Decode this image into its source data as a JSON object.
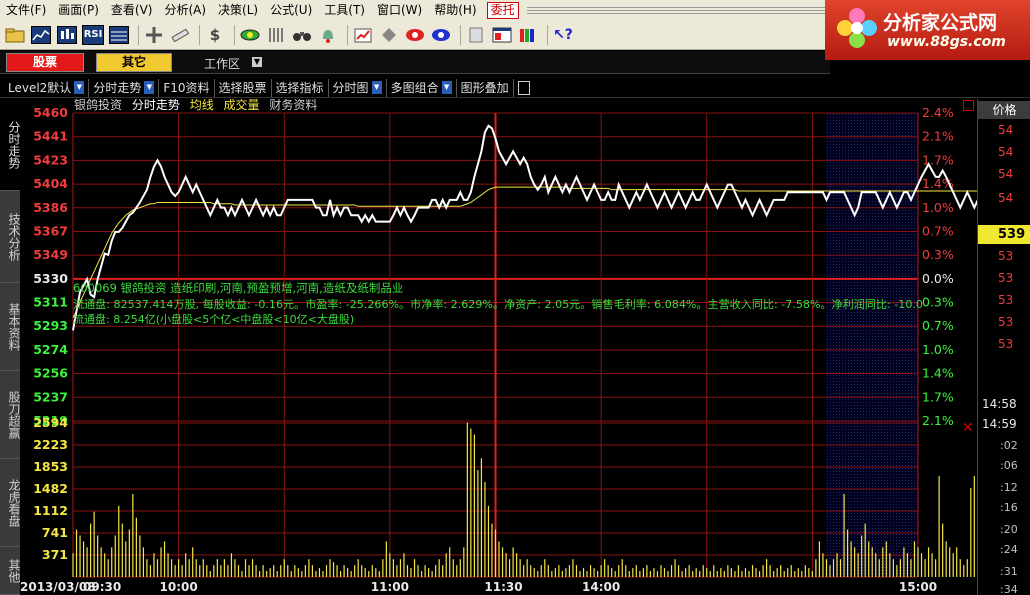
{
  "menus": [
    "文件(F)",
    "画面(P)",
    "查看(V)",
    "分析(A)",
    "决策(L)",
    "公式(U)",
    "工具(T)",
    "窗口(W)",
    "帮助(H)"
  ],
  "entrust_label": "委托",
  "logo": {
    "title": "分析家公式网",
    "url": "www.88gs.com"
  },
  "toolbar_rsi": "RSI",
  "sector_tabs": {
    "stocks": "股票",
    "other": "其它",
    "workspace": "工作区"
  },
  "func_tabs": [
    "Level2默认",
    "分时走势",
    "F10资料",
    "选择股票",
    "选择指标",
    "分时图",
    "多图组合",
    "图形叠加"
  ],
  "side_tabs": [
    "分时走势",
    "技术分析",
    "基本资料",
    "股刀超赢",
    "龙虎看盘",
    "其他"
  ],
  "chart_header": [
    "银鸽投资",
    "分时走势",
    "均线",
    "成交量",
    "财务资料"
  ],
  "colors": {
    "price_line": "#ffffff",
    "avg_line": "#f5e642",
    "volume": "#f5e642",
    "grid": "#b01818",
    "up": "#f03c3c",
    "down": "#3cf03c",
    "info_text": "#3cdc3c"
  },
  "info_lines": [
    "600069 银鸽投资 造纸印刷,河南,预盈预增,河南,造纸及纸制品业",
    "流通盘: 82537.414万股, 每股收益: -0.16元。市盈率: -25.266%。市净率: 2.629%。净资产: 2.05元。销售毛利率: 6.084%。主营收入同比: -7.58%。净利润同比: -10.0",
    "流通盘: 8.254亿(小盘股<5个亿<中盘股<10亿<大盘股)"
  ],
  "price_axis": [
    "5460",
    "5441",
    "5423",
    "5404",
    "5386",
    "5367",
    "5349",
    "5330",
    "5311",
    "5293",
    "5274",
    "5256",
    "5237",
    "5219"
  ],
  "pct_axis": [
    "2.4%",
    "2.1%",
    "1.7%",
    "1.4%",
    "1.0%",
    "0.7%",
    "0.3%",
    "0.0%",
    "0.3%",
    "0.7%",
    "1.0%",
    "1.4%",
    "1.7%",
    "2.1%"
  ],
  "volume_axis": [
    "2594",
    "2223",
    "1853",
    "1482",
    "1112",
    "741",
    "371"
  ],
  "time_axis": [
    "2013/03/08",
    "09:30",
    "10:00",
    "11:00",
    "11:30",
    "14:00",
    "15:00"
  ],
  "right_panel": {
    "header": "价格",
    "prices": [
      "54",
      "54",
      "54",
      "54"
    ],
    "current": "539",
    "lower_prices": [
      "53",
      "53",
      "53",
      "53",
      "53"
    ],
    "times": [
      "14:58",
      "14:59"
    ],
    "seconds": [
      ":02",
      ":06",
      ":12",
      ":16",
      ":20",
      ":24",
      ":31",
      ":34"
    ]
  },
  "chart_data": {
    "type": "line",
    "price_range": [
      5219,
      5460
    ],
    "base_price": 5330,
    "price": [
      5290,
      5305,
      5320,
      5325,
      5330,
      5318,
      5316,
      5330,
      5340,
      5350,
      5349,
      5360,
      5367,
      5367,
      5370,
      5375,
      5380,
      5382,
      5386,
      5390,
      5395,
      5400,
      5410,
      5418,
      5423,
      5418,
      5410,
      5404,
      5398,
      5395,
      5398,
      5404,
      5410,
      5404,
      5398,
      5404,
      5398,
      5392,
      5386,
      5380,
      5386,
      5392,
      5386,
      5386,
      5380,
      5386,
      5380,
      5386,
      5392,
      5386,
      5380,
      5386,
      5392,
      5386,
      5380,
      5386,
      5380,
      5386,
      5380,
      5380,
      5386,
      5392,
      5392,
      5392,
      5392,
      5392,
      5392,
      5392,
      5392,
      5386,
      5386,
      5380,
      5380,
      5392,
      5380,
      5386,
      5380,
      5386,
      5386,
      5380,
      5380,
      5380,
      5375,
      5380,
      5375,
      5380,
      5375,
      5375,
      5375,
      5375,
      5375,
      5380,
      5386,
      5380,
      5386,
      5380,
      5375,
      5380,
      5386,
      5386,
      5386,
      5386,
      5392,
      5392,
      5386,
      5392,
      5386,
      5392,
      5392,
      5392,
      5398,
      5392,
      5392,
      5398,
      5410,
      5420,
      5430,
      5445,
      5450,
      5448,
      5440,
      5430,
      5425,
      5420,
      5425,
      5430,
      5425,
      5420,
      5425,
      5420,
      5410,
      5404,
      5400,
      5404,
      5410,
      5398,
      5404,
      5410,
      5404,
      5398,
      5404,
      5398,
      5404,
      5410,
      5404,
      5398,
      5392,
      5398,
      5404,
      5398,
      5392,
      5392,
      5398,
      5392,
      5392,
      5404,
      5398,
      5392,
      5386,
      5392,
      5398,
      5392,
      5398,
      5404,
      5398,
      5392,
      5386,
      5392,
      5398,
      5392,
      5386,
      5392,
      5398,
      5392,
      5386,
      5392,
      5398,
      5392,
      5392,
      5398,
      5404,
      5398,
      5392,
      5386,
      5392,
      5398,
      5404,
      5404,
      5398,
      5392,
      5386,
      5392,
      5386,
      5380,
      5386,
      5392,
      5386,
      5380,
      5386,
      5392,
      5392,
      5392,
      5392,
      5398,
      5398,
      5398,
      5398,
      5398,
      5398,
      5398,
      5398,
      5398,
      5398,
      5398,
      5392,
      5398,
      5398,
      5398,
      5398,
      5398,
      5392,
      5386,
      5380,
      5386,
      5398,
      5398,
      5398,
      5398,
      5398,
      5392,
      5386,
      5392,
      5398,
      5392,
      5386,
      5392,
      5398,
      5398,
      5392,
      5398,
      5404,
      5410,
      5415,
      5420,
      5415,
      5410,
      5410,
      5415,
      5410,
      5404,
      5398,
      5392,
      5386,
      5392,
      5398,
      5392,
      5386,
      5392,
      5398,
      5398,
      5404,
      5398,
      5404,
      5410,
      5404,
      5398,
      5398,
      5404,
      5404,
      5404,
      5398,
      5398,
      5398,
      5398,
      5398,
      5392,
      5392,
      5390
    ],
    "avg": [
      5300,
      5305,
      5312,
      5318,
      5324,
      5330,
      5336,
      5342,
      5348,
      5354,
      5360,
      5366,
      5370,
      5374,
      5377,
      5380,
      5382,
      5384,
      5385,
      5386,
      5387,
      5388,
      5389,
      5389,
      5390,
      5390,
      5390,
      5390,
      5390,
      5390,
      5390,
      5390,
      5390,
      5390,
      5390,
      5390,
      5390,
      5390,
      5390,
      5390,
      5389,
      5389,
      5389,
      5389,
      5389,
      5389,
      5388,
      5388,
      5388,
      5388,
      5388,
      5388,
      5388,
      5388,
      5388,
      5388,
      5388,
      5388,
      5388,
      5388,
      5388,
      5388,
      5388,
      5388,
      5388,
      5388,
      5388,
      5388,
      5388,
      5388,
      5388,
      5388,
      5388,
      5388,
      5388,
      5388,
      5388,
      5388,
      5388,
      5388,
      5388,
      5387,
      5387,
      5387,
      5387,
      5387,
      5387,
      5387,
      5387,
      5387,
      5387,
      5387,
      5387,
      5387,
      5387,
      5387,
      5387,
      5387,
      5387,
      5387,
      5387,
      5387,
      5387,
      5387,
      5387,
      5387,
      5387,
      5387,
      5387,
      5387,
      5387,
      5388,
      5389,
      5390,
      5392,
      5394,
      5396,
      5398,
      5400,
      5401,
      5402,
      5402,
      5402,
      5402,
      5402,
      5402,
      5402,
      5402,
      5402,
      5402,
      5402,
      5402,
      5402,
      5402,
      5402,
      5402,
      5402,
      5402,
      5402,
      5402,
      5402,
      5401,
      5401,
      5401,
      5401,
      5401,
      5401,
      5401,
      5401,
      5401,
      5401,
      5401,
      5401,
      5400,
      5400,
      5400,
      5400,
      5400,
      5400,
      5400,
      5400,
      5400,
      5400,
      5400,
      5400,
      5400,
      5400,
      5400,
      5400,
      5400,
      5400,
      5400,
      5400,
      5400,
      5400,
      5400,
      5400,
      5400,
      5400,
      5400,
      5400,
      5400,
      5400,
      5400,
      5400,
      5400,
      5400,
      5400,
      5400,
      5399,
      5399,
      5399,
      5399,
      5399,
      5399,
      5399,
      5399,
      5399,
      5399,
      5399,
      5399,
      5399,
      5399,
      5399,
      5399,
      5399,
      5399,
      5399,
      5399,
      5399,
      5399,
      5399,
      5399,
      5399,
      5399,
      5399,
      5399,
      5399,
      5399,
      5399,
      5399,
      5399,
      5399,
      5399,
      5399,
      5399,
      5399,
      5399,
      5399,
      5399,
      5399,
      5399,
      5399,
      5399,
      5399,
      5399,
      5399,
      5399,
      5399,
      5399,
      5399,
      5399,
      5399,
      5399,
      5399,
      5399,
      5399,
      5399,
      5399,
      5399,
      5399,
      5399,
      5399,
      5399,
      5399,
      5399,
      5399,
      5399,
      5399,
      5399,
      5399,
      5399,
      5399,
      5399,
      5399,
      5399,
      5399
    ],
    "volume": [
      400,
      800,
      700,
      600,
      500,
      900,
      1100,
      700,
      500,
      400,
      300,
      500,
      700,
      1200,
      900,
      600,
      800,
      1400,
      1000,
      700,
      500,
      300,
      200,
      400,
      300,
      500,
      600,
      400,
      300,
      200,
      300,
      200,
      400,
      300,
      500,
      300,
      200,
      300,
      200,
      100,
      200,
      300,
      200,
      300,
      200,
      400,
      300,
      200,
      100,
      300,
      200,
      300,
      200,
      100,
      200,
      100,
      150,
      200,
      100,
      200,
      300,
      200,
      100,
      200,
      150,
      100,
      200,
      300,
      200,
      100,
      150,
      100,
      200,
      300,
      250,
      200,
      100,
      200,
      150,
      100,
      200,
      300,
      200,
      150,
      100,
      200,
      150,
      100,
      300,
      600,
      400,
      300,
      200,
      300,
      400,
      200,
      150,
      300,
      200,
      100,
      200,
      150,
      100,
      200,
      300,
      200,
      400,
      500,
      300,
      200,
      300,
      500,
      2600,
      2500,
      2400,
      1800,
      2000,
      1600,
      1200,
      900,
      800,
      600,
      500,
      400,
      300,
      500,
      400,
      300,
      200,
      300,
      200,
      150,
      100,
      200,
      300,
      200,
      100,
      150,
      200,
      100,
      150,
      200,
      300,
      200,
      100,
      150,
      100,
      200,
      150,
      100,
      200,
      300,
      200,
      150,
      100,
      200,
      300,
      200,
      100,
      150,
      200,
      100,
      150,
      200,
      100,
      150,
      100,
      200,
      150,
      100,
      200,
      300,
      200,
      100,
      150,
      200,
      100,
      150,
      100,
      200,
      150,
      100,
      200,
      100,
      150,
      100,
      200,
      150,
      100,
      200,
      100,
      150,
      100,
      200,
      150,
      100,
      200,
      300,
      200,
      100,
      150,
      200,
      100,
      150,
      200,
      100,
      150,
      100,
      200,
      150,
      100,
      300,
      600,
      400,
      300,
      200,
      300,
      400,
      300,
      1400,
      800,
      600,
      500,
      400,
      700,
      900,
      600,
      500,
      400,
      300,
      500,
      600,
      400,
      300,
      200,
      300,
      500,
      400,
      300,
      600,
      500,
      400,
      300,
      500,
      400,
      300,
      1700,
      900,
      600,
      500,
      400,
      500,
      300,
      200,
      300,
      1500,
      1700
    ],
    "volume_max": 2594,
    "total_minutes": 240,
    "plotted_minutes": 240
  }
}
